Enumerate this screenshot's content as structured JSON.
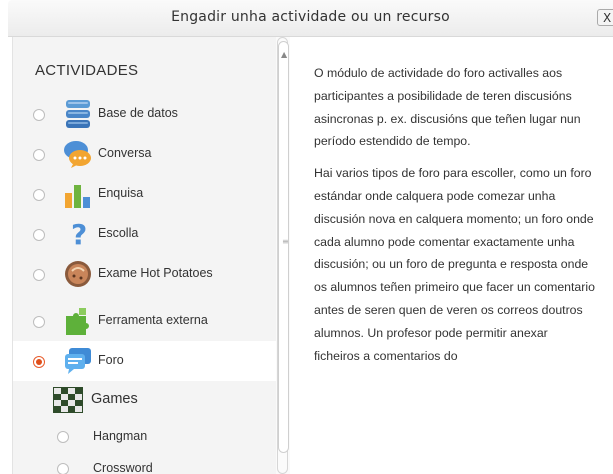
{
  "dialog": {
    "title": "Engadir unha actividade ou un recurso",
    "close_label": "X"
  },
  "left": {
    "section_title": "ACTIVIDADES",
    "options": [
      {
        "label": "Base de datos",
        "icon": "database-icon",
        "selected": false
      },
      {
        "label": "Conversa",
        "icon": "chat-icon",
        "selected": false
      },
      {
        "label": "Enquisa",
        "icon": "survey-chart-icon",
        "selected": false
      },
      {
        "label": "Escolla",
        "icon": "question-mark-icon",
        "selected": false
      },
      {
        "label": "Exame Hot Potatoes",
        "icon": "hot-potatoes-icon",
        "selected": false
      },
      {
        "label": "Ferramenta externa",
        "icon": "puzzle-piece-icon",
        "selected": false
      },
      {
        "label": "Foro",
        "icon": "forum-icon",
        "selected": true
      }
    ],
    "group": {
      "label": "Games",
      "icon": "games-icon"
    },
    "sub_options": [
      {
        "label": "Hangman",
        "selected": false
      },
      {
        "label": "Crossword",
        "selected": false
      }
    ]
  },
  "description": {
    "paragraphs": [
      "O módulo de actividade do foro activalles aos participantes a posibilidade de teren discusións asincronas p. ex. discusións que teñen lugar nun período estendido de tempo.",
      "Hai varios tipos de foro para escoller, como un foro estándar onde calquera pode comezar unha discusión nova en calquera momento; un foro onde cada alumno pode comentar exactamente unha discusión; ou un foro de pregunta e resposta onde os alumnos teñen primeiro que facer un comentario antes de seren quen de veren os correos doutros alumnos. Un profesor pode permitir anexar ficheiros a comentarios do"
    ]
  },
  "colors": {
    "selected_radio": "#e04f1a",
    "panel_bg": "#f4f4f4"
  }
}
